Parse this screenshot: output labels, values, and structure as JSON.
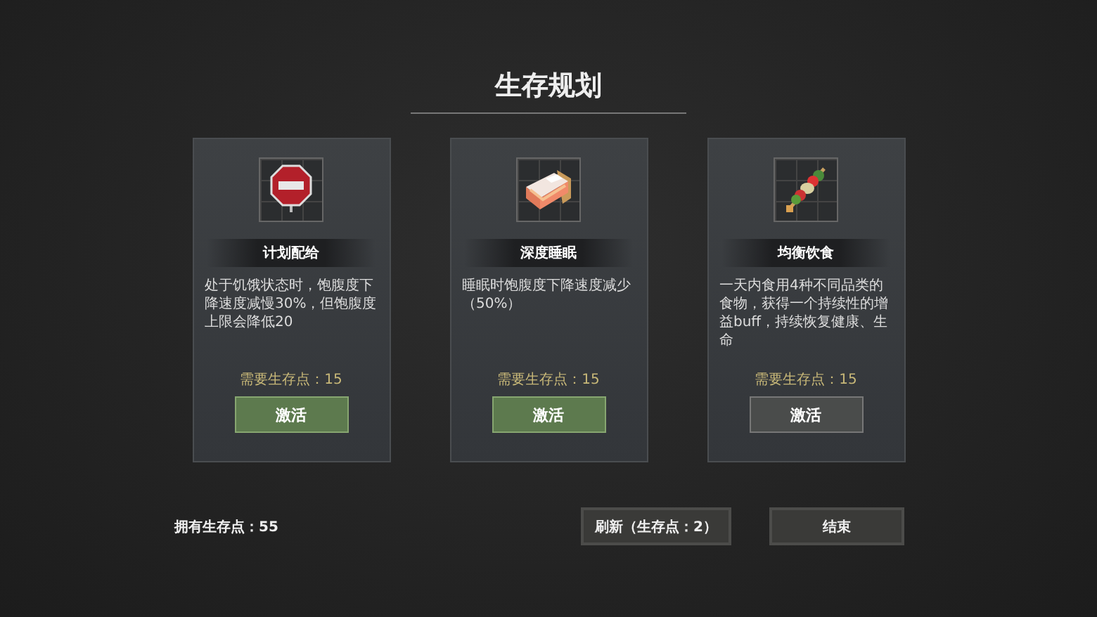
{
  "title": "生存规划",
  "cards": [
    {
      "name": "计划配给",
      "description": "处于饥饿状态时，饱腹度下降速度减慢30%，但饱腹度上限会降低20",
      "cost": "需要生存点：15",
      "button": "激活",
      "highlighted": true
    },
    {
      "name": "深度睡眠",
      "description": "睡眠时饱腹度下降速度减少（50%）",
      "cost": "需要生存点：15",
      "button": "激活",
      "highlighted": true
    },
    {
      "name": "均衡饮食",
      "description": "一天内食用4种不同品类的食物，获得一个持续性的增益buff，持续恢复健康、生命",
      "cost": "需要生存点：15",
      "button": "激活",
      "highlighted": false
    }
  ],
  "points": "拥有生存点：55",
  "buttons": [
    "刷新（生存点：2）",
    "结束"
  ]
}
